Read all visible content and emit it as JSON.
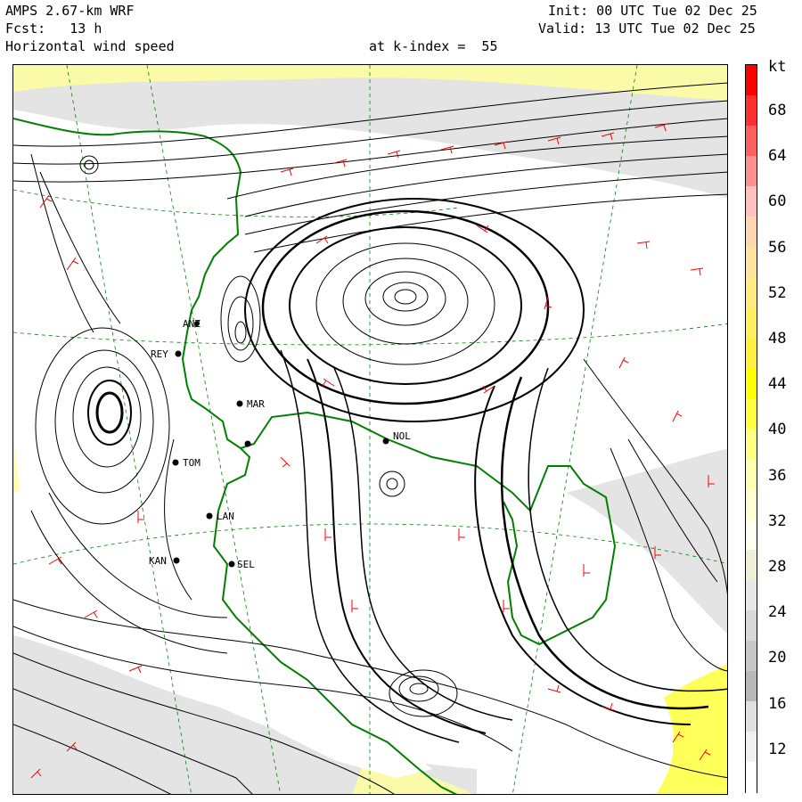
{
  "header": {
    "model": "AMPS 2.67-km WRF",
    "forecast": "Fcst:   13 h",
    "field": "Horizontal wind speed",
    "level": "at k-index =  55",
    "init": "Init: 00 UTC Tue 02 Dec 25",
    "valid": "Valid: 13 UTC Tue 02 Dec 25"
  },
  "colorbar": {
    "unit": "kt",
    "ticks": [
      "68",
      "64",
      "60",
      "56",
      "52",
      "48",
      "44",
      "40",
      "36",
      "32",
      "28",
      "24",
      "20",
      "16",
      "12"
    ],
    "colors": [
      "#ff0000",
      "#ff3030",
      "#ff6060",
      "#ff9090",
      "#ffc0c0",
      "#ffd8b0",
      "#ffe4a0",
      "#ffec80",
      "#fff060",
      "#fff040",
      "#ffff00",
      "#ffff40",
      "#ffff80",
      "#ffffb0",
      "#ffffd0",
      "#fffff0",
      "#f0f0d8",
      "#e8e8e8",
      "#d8d8d8",
      "#c8c8c8",
      "#b8b8b8",
      "#e0e0e0",
      "#f0f0f0",
      "#ffffff"
    ]
  },
  "stations": [
    {
      "code": "ANZ"
    },
    {
      "code": "REY"
    },
    {
      "code": "MAR"
    },
    {
      "code": "TOM"
    },
    {
      "code": "LAN"
    },
    {
      "code": "KAN"
    },
    {
      "code": "SEL"
    },
    {
      "code": "NOL"
    }
  ]
}
